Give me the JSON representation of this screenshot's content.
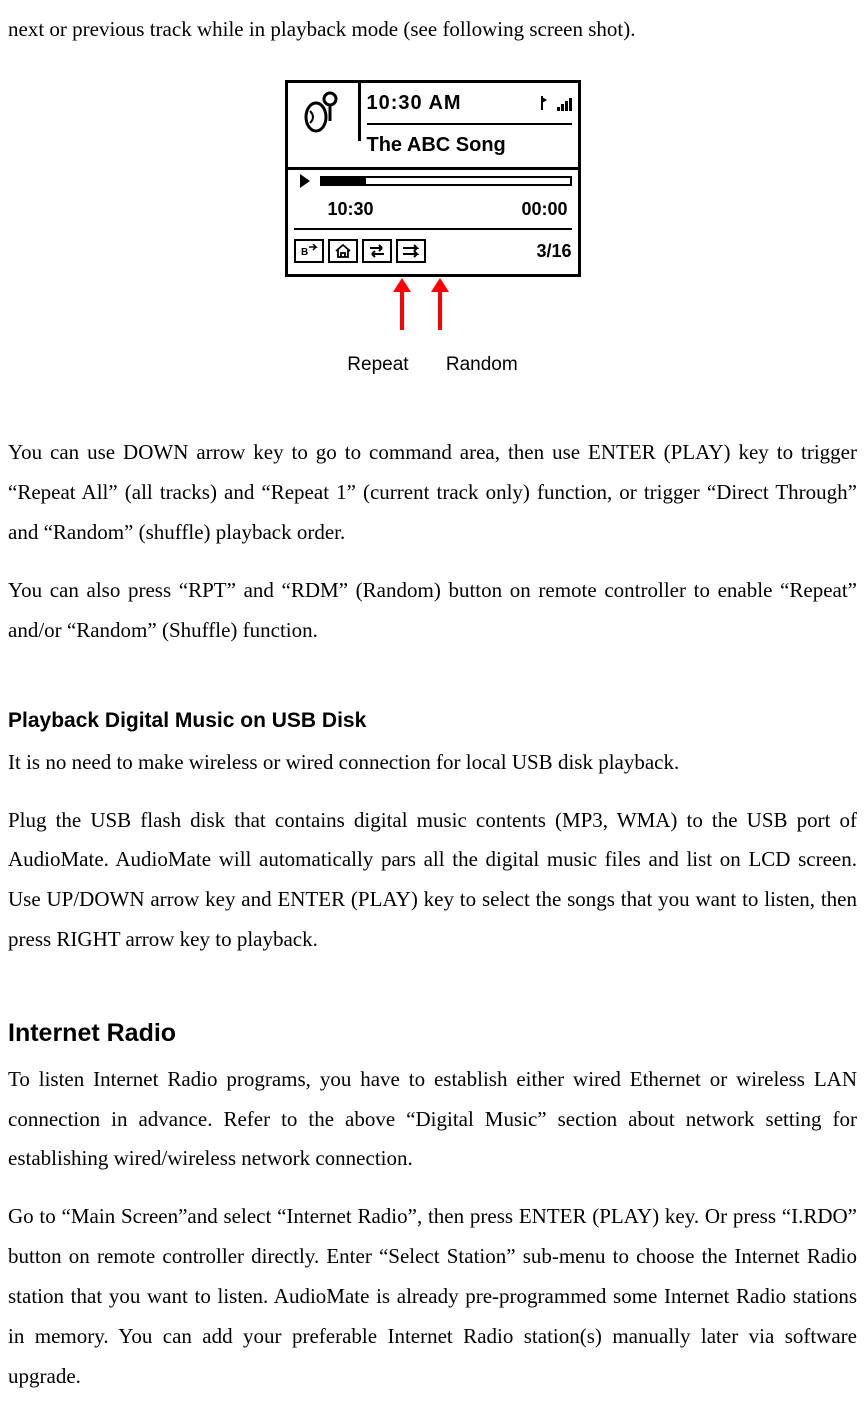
{
  "intro_line": "next or previous track while in playback mode (see following screen shot).",
  "lcd": {
    "clock": "10:30 AM",
    "song": "The ABC Song",
    "elapsed": "10:30",
    "remaining": "00:00",
    "track_index": "3/16"
  },
  "callouts": {
    "repeat": "Repeat",
    "random": "Random"
  },
  "para1": "You can use DOWN arrow key to go to command area, then use ENTER (PLAY) key to trigger “Repeat All” (all tracks) and “Repeat 1” (current track only) function, or trigger “Direct Through” and “Random” (shuffle) playback order.",
  "para2": "You can also press “RPT” and “RDM” (Random) button on remote controller to enable “Repeat” and/or “Random” (Shuffle) function.",
  "heading_usb": "Playback Digital Music on USB Disk",
  "para_usb1": "It is no need to make wireless or wired connection for local USB disk playback.",
  "para_usb2": "Plug the USB flash disk that contains digital music contents (MP3, WMA) to the USB port of AudioMate. AudioMate will automatically pars all the digital music files and list on LCD screen. Use UP/DOWN arrow key and ENTER (PLAY) key to select the songs that you want to listen, then press RIGHT arrow key to playback.",
  "heading_radio": "Internet Radio",
  "para_radio1": "To listen Internet Radio programs, you have to establish either wired Ethernet or wireless LAN connection in advance. Refer to the above “Digital Music” section about network setting for establishing wired/wireless network connection.",
  "para_radio2": "Go to “Main Screen”and select “Internet Radio”, then press ENTER (PLAY) key. Or press “I.RDO” button on remote controller directly. Enter “Select Station” sub-menu to choose the Internet Radio station that you want to listen. AudioMate is already pre-programmed some Internet Radio stations in memory. You can add your preferable Internet Radio station(s) manually later via software upgrade."
}
